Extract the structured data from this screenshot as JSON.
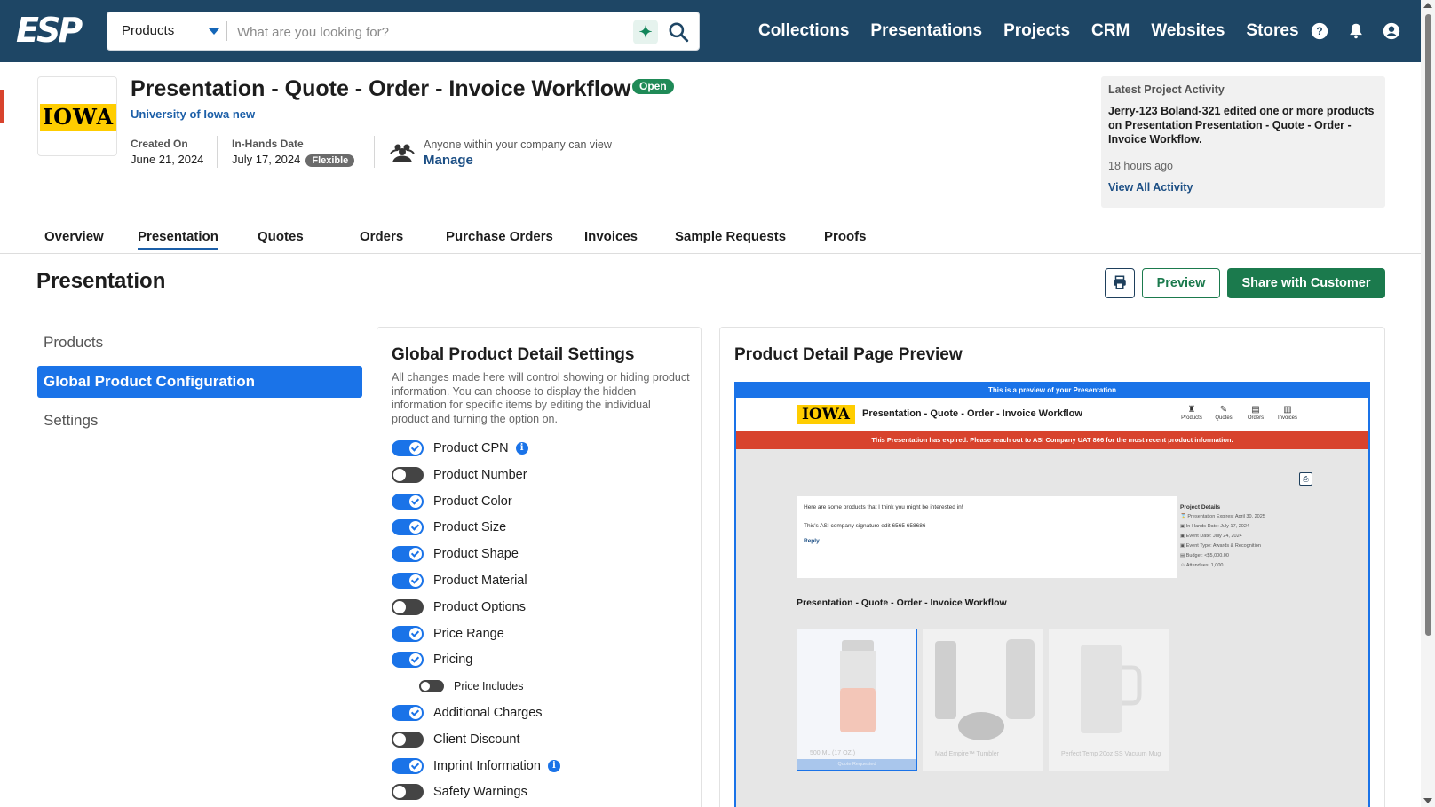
{
  "topbar": {
    "logo_text": "ESP",
    "search": {
      "selected_option": "Products",
      "placeholder": "What are you looking for?"
    },
    "nav_links": [
      "Collections",
      "Presentations",
      "Projects",
      "CRM",
      "Websites",
      "Stores"
    ],
    "icons": [
      "ai-sparkle-icon",
      "search-icon",
      "help-icon",
      "bell-icon",
      "account-icon"
    ],
    "bg_color": "#1e4665"
  },
  "project": {
    "logo_text": "IOWA",
    "title": "Presentation - Quote - Order - Invoice Workflow",
    "status": "Open",
    "customer": "University of Iowa new",
    "created_label": "Created On",
    "created_value": "June 21, 2024",
    "inhands_label": "In-Hands Date",
    "inhands_value": "July 17, 2024",
    "inhands_badge": "Flexible",
    "visibility_text": "Anyone within your company can view",
    "manage_label": "Manage"
  },
  "activity": {
    "title": "Latest Project Activity",
    "body": "Jerry-123 Boland-321 edited one or more products on Presentation Presentation - Quote - Order - Invoice Workflow.",
    "time": "18 hours ago",
    "link": "View All Activity"
  },
  "tabs": [
    {
      "label": "Overview",
      "active": false
    },
    {
      "label": "Presentation",
      "active": true
    },
    {
      "label": "Quotes",
      "active": false
    },
    {
      "label": "Orders",
      "active": false
    },
    {
      "label": "Purchase Orders",
      "active": false
    },
    {
      "label": "Invoices",
      "active": false
    },
    {
      "label": "Sample Requests",
      "active": false
    },
    {
      "label": "Proofs",
      "active": false
    }
  ],
  "page": {
    "title": "Presentation",
    "preview_label": "Preview",
    "share_label": "Share with Customer"
  },
  "sidenav": [
    {
      "label": "Products",
      "active": false
    },
    {
      "label": "Global Product Configuration",
      "active": true
    },
    {
      "label": "Settings",
      "active": false
    }
  ],
  "settings": {
    "title": "Global Product Detail Settings",
    "description": "All changes made here will control showing or hiding product information. You can choose to display the hidden information for specific items by editing the individual product and turning the option on.",
    "toggles": [
      {
        "label": "Product CPN",
        "on": true,
        "info": true
      },
      {
        "label": "Product Number",
        "on": false
      },
      {
        "label": "Product Color",
        "on": true
      },
      {
        "label": "Product Size",
        "on": true
      },
      {
        "label": "Product Shape",
        "on": true
      },
      {
        "label": "Product Material",
        "on": true
      },
      {
        "label": "Product Options",
        "on": false
      },
      {
        "label": "Price Range",
        "on": true
      },
      {
        "label": "Pricing",
        "on": true
      },
      {
        "label": "Price Includes",
        "on": false,
        "sub": true
      },
      {
        "label": "Additional Charges",
        "on": true
      },
      {
        "label": "Client Discount",
        "on": false
      },
      {
        "label": "Imprint Information",
        "on": true,
        "info": true
      },
      {
        "label": "Safety Warnings",
        "on": false
      }
    ]
  },
  "preview": {
    "title": "Product Detail Page Preview",
    "banner": "This is a preview of your Presentation",
    "logo_text": "IOWA",
    "header_title": "Presentation - Quote - Order - Invoice Workflow",
    "nav": [
      "Products",
      "Quotes",
      "Orders",
      "Invoices"
    ],
    "expired_notice": "This Presentation has expired. Please reach out to ASI Company UAT 866 for the most recent product information.",
    "message_line1": "Here are some products that I think you might be interested in!",
    "message_line2": "This's ASI company signature edit 6565 658686",
    "reply_label": "Reply",
    "details_title": "Project Details",
    "details": [
      "Presentation Expires: April 30, 2025",
      "In-Hands Date: July 17, 2024",
      "Event Date: July 24, 2024",
      "Event Type: Awards & Recognition",
      "Budget: <$5,000.00",
      "Attendees: 1,000"
    ],
    "section_title": "Presentation - Quote - Order - Invoice Workflow",
    "products": [
      {
        "name": "500 ML (17 OZ.)",
        "bar": "Quote Requested"
      },
      {
        "name": "Mad Empire™ Tumbler",
        "bar": ""
      },
      {
        "name": "Perfect Temp 20oz SS Vacuum Mug",
        "bar": ""
      }
    ]
  }
}
